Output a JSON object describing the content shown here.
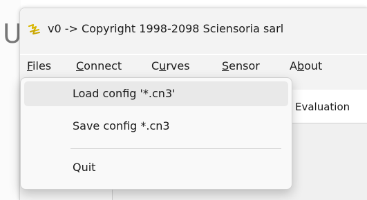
{
  "background": {
    "partial_letter": "U"
  },
  "window": {
    "title": "v0 -> Copyright 1998-2098 Sciensoria sarl",
    "icon": "sciensoria-app-icon",
    "icon_color": "#d8b600"
  },
  "menubar": {
    "items": [
      {
        "label": "Files",
        "mnemonic": "F",
        "rest": "iles"
      },
      {
        "label": "Connect",
        "mnemonic": "C",
        "rest": "onnect"
      },
      {
        "label": "Curves",
        "pre": "C",
        "mnemonic": "u",
        "rest": "rves"
      },
      {
        "label": "Sensor",
        "mnemonic": "S",
        "rest": "ensor"
      },
      {
        "label": "About",
        "pre": "A",
        "mnemonic": "b",
        "rest": "out"
      }
    ]
  },
  "tabs": {
    "evaluation_label": "Evaluation"
  },
  "files_menu": {
    "items": [
      {
        "label": "Load config '*.cn3'"
      },
      {
        "label": "Save config *.cn3"
      },
      {
        "label": "Quit"
      }
    ],
    "hover_color": "#e9e9e9"
  }
}
